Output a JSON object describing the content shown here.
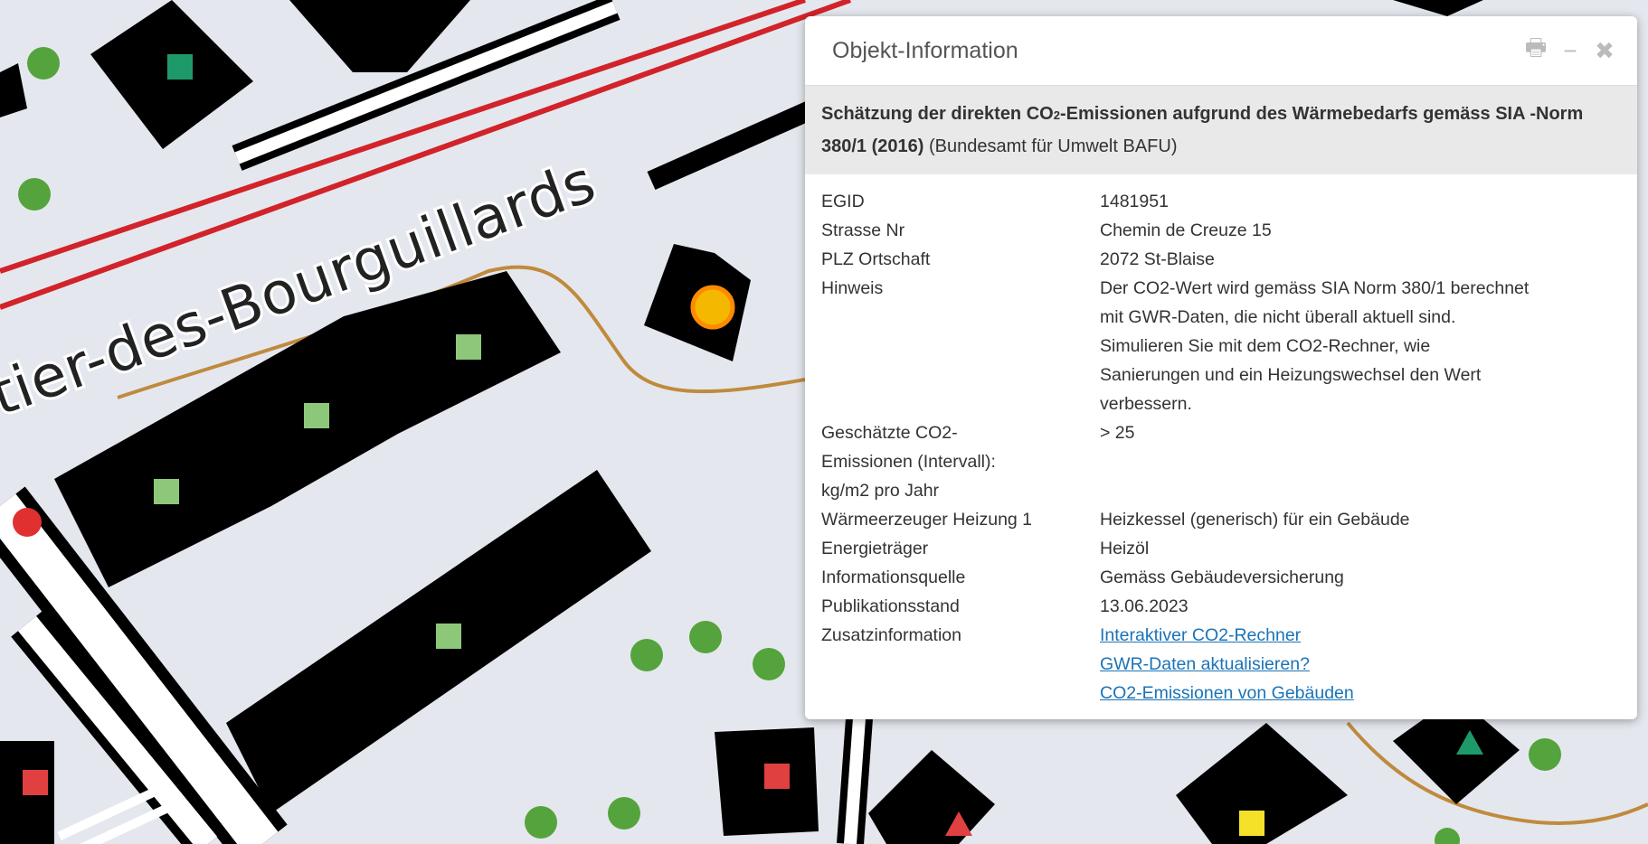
{
  "map": {
    "street_label": "tier-des-Bourguillards",
    "colors": {
      "background": "#e4e8ee",
      "building": "#000000",
      "rail": "#d2232a",
      "path": "#c08a3e",
      "tree": "#55a33d",
      "marker_light_green": "#8dc87a",
      "marker_dark_green": "#1e9a6a",
      "marker_red": "#e04040",
      "marker_yellow": "#f5e12a",
      "selected_point": "#f5b800"
    }
  },
  "popup": {
    "title": "Objekt-Information",
    "tools": [
      {
        "name": "print-icon",
        "glyph": "🖶"
      },
      {
        "name": "minimize-icon",
        "glyph": "−"
      },
      {
        "name": "close-icon",
        "glyph": "✖"
      }
    ],
    "layer": {
      "title_part1": "Schätzung der direkten CO",
      "title_sub": "2",
      "title_part2": "-Emissionen aufgrund des Wärmebedarfs gemäss SIA -Norm 380/1 (2016)",
      "source": " (Bundesamt für Umwelt BAFU)"
    },
    "rows": [
      {
        "key": "EGID",
        "value": "1481951"
      },
      {
        "key": "Strasse Nr",
        "value": "Chemin de Creuze 15"
      },
      {
        "key": "PLZ Ortschaft",
        "value": "2072 St-Blaise"
      },
      {
        "key": "Hinweis",
        "lines": [
          "Der CO2-Wert wird gemäss SIA Norm 380/1 berechnet",
          "mit GWR-Daten, die nicht überall aktuell sind.",
          "Simulieren Sie mit dem CO2-Rechner, wie",
          "Sanierungen und ein Heizungswechsel den Wert",
          "verbessern."
        ]
      },
      {
        "key_lines": [
          "Geschätzte CO2-",
          "Emissionen (Intervall):",
          "kg/m2 pro Jahr"
        ],
        "value": "> 25"
      },
      {
        "key": "Wärmeerzeuger Heizung 1",
        "value": "Heizkessel (generisch) für ein Gebäude"
      },
      {
        "key": "Energieträger",
        "value": "Heizöl"
      },
      {
        "key": "Informationsquelle",
        "value": "Gemäss Gebäudeversicherung"
      },
      {
        "key": "Publikationsstand",
        "value": "13.06.2023"
      },
      {
        "key": "Zusatzinformation",
        "links": [
          "Interaktiver CO2-Rechner",
          "GWR-Daten aktualisieren?",
          "CO2-Emissionen von Gebäuden"
        ]
      }
    ]
  }
}
